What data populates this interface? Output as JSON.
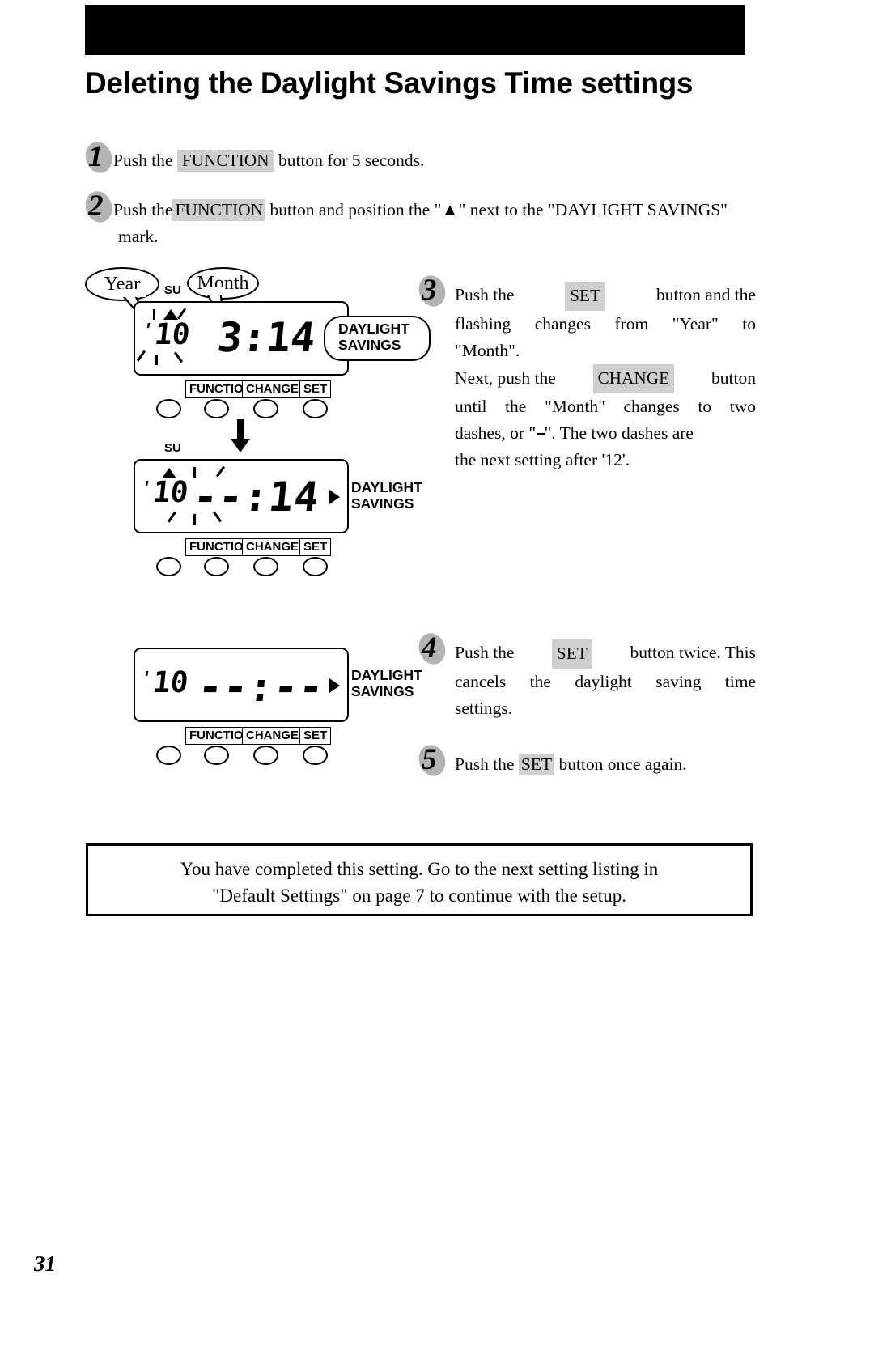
{
  "document": {
    "page_number": "31",
    "title": "Deleting the Daylight Savings Time settings"
  },
  "steps": [
    {
      "number": "1",
      "text_before": "Push the",
      "key": "FUNCTION",
      "text_after": "button for 5 seconds."
    },
    {
      "number": "2",
      "text_before": "Push the",
      "key": "FUNCTION",
      "text_mid": "button and position the \"▲\" next to the \"DAYLIGHT SAVINGS\"",
      "text_cont": "mark."
    },
    {
      "number": "3",
      "line1_a": "Push the",
      "key1": "SET",
      "line1_b": "button and the",
      "line2": "flashing changes from \"Year\" to",
      "line3": "\"Month\".",
      "line4_a": "Next, push the",
      "key2": "CHANGE",
      "line4_b": "button",
      "line5": "until the \"Month\" changes to two",
      "line6_a": "dashes, or \"",
      "dash_glyph": "--",
      "line6_b": "\". The two dashes are",
      "line7": "the next setting after '12'."
    },
    {
      "number": "4",
      "line1_a": "Push the",
      "key1": "SET",
      "line1_b": "button twice. This",
      "line2": "cancels the daylight saving time",
      "line3": "settings."
    },
    {
      "number": "5",
      "line1_a": "Push the",
      "key1": "SET",
      "line1_b": "button once again."
    }
  ],
  "callouts": {
    "year": "Year",
    "month": "Month"
  },
  "displays": [
    {
      "id": "display-1",
      "weekday_indicator": "SU",
      "year": "10",
      "year_prefix": "'",
      "main": "3:14",
      "month": "3",
      "day": "14",
      "daylight_label_line1": "DAYLIGHT",
      "daylight_label_line2": "SAVINGS",
      "year_flashing": true,
      "bubble_style": true
    },
    {
      "id": "display-2",
      "weekday_indicator": "SU",
      "year": "10",
      "year_prefix": "'",
      "main": "--:14",
      "month": "--",
      "day": "14",
      "daylight_label_line1": "DAYLIGHT",
      "daylight_label_line2": "SAVINGS",
      "year_flashing": true,
      "bubble_style": false
    },
    {
      "id": "display-3",
      "weekday_indicator": "",
      "year": "10",
      "year_prefix": "'",
      "main": "--:--",
      "month": "--",
      "day": "--",
      "daylight_label_line1": "DAYLIGHT",
      "daylight_label_line2": "SAVINGS",
      "year_flashing": false,
      "bubble_style": false
    }
  ],
  "device_buttons": [
    "FUNCTION",
    "CHANGE",
    "SET"
  ],
  "completion_note": {
    "line1": "You have completed this setting.  Go to the next setting listing in",
    "line2": "\"Default Settings\" on page 7 to continue with the setup."
  }
}
